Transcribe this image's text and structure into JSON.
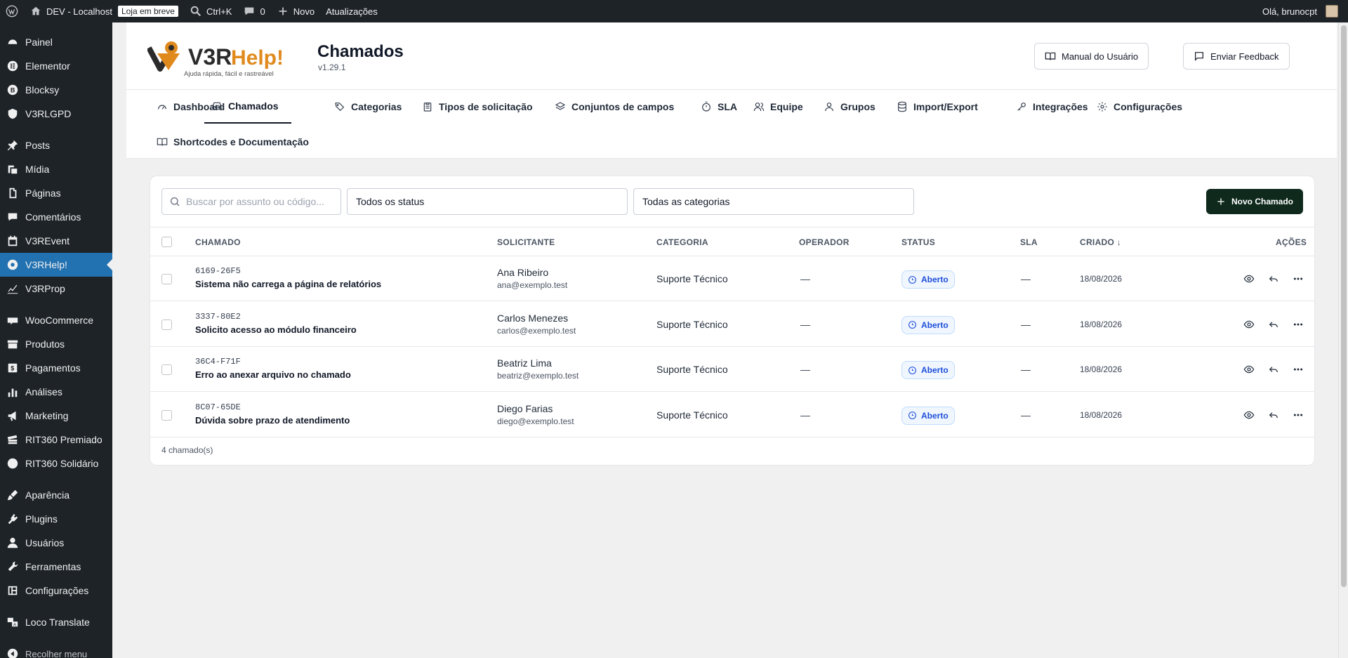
{
  "adminbar": {
    "site_name": "DEV - Localhost",
    "badge": "Loja em breve",
    "search_shortcut": "Ctrl+K",
    "comments_count": "0",
    "new_label": "Novo",
    "updates_label": "Atualizações",
    "greeting": "Olá, brunocpt"
  },
  "sidebar": {
    "items": [
      {
        "label": "Painel",
        "icon": "dashboard-icon"
      },
      {
        "label": "Elementor",
        "icon": "elementor-icon"
      },
      {
        "label": "Blocksy",
        "icon": "blocksy-icon"
      },
      {
        "label": "V3RLGPD",
        "icon": "shield-icon"
      },
      {
        "label": "Posts",
        "icon": "pin-icon"
      },
      {
        "label": "Mídia",
        "icon": "media-icon"
      },
      {
        "label": "Páginas",
        "icon": "pages-icon"
      },
      {
        "label": "Comentários",
        "icon": "comment-icon"
      },
      {
        "label": "V3REvent",
        "icon": "calendar-icon"
      },
      {
        "label": "V3RHelp!",
        "icon": "help-icon"
      },
      {
        "label": "V3RProp",
        "icon": "chart-icon"
      },
      {
        "label": "WooCommerce",
        "icon": "woo-icon"
      },
      {
        "label": "Produtos",
        "icon": "archive-icon"
      },
      {
        "label": "Pagamentos",
        "icon": "money-icon"
      },
      {
        "label": "Análises",
        "icon": "bar-chart-icon"
      },
      {
        "label": "Marketing",
        "icon": "megaphone-icon"
      },
      {
        "label": "RIT360 Premiado",
        "icon": "ticket-icon"
      },
      {
        "label": "RIT360 Solidário",
        "icon": "circle-icon"
      },
      {
        "label": "Aparência",
        "icon": "brush-icon"
      },
      {
        "label": "Plugins",
        "icon": "plugin-icon"
      },
      {
        "label": "Usuários",
        "icon": "user-icon"
      },
      {
        "label": "Ferramentas",
        "icon": "wrench-icon"
      },
      {
        "label": "Configurações",
        "icon": "settings-icon"
      },
      {
        "label": "Loco Translate",
        "icon": "translate-icon"
      },
      {
        "label": "Recolher menu",
        "icon": "collapse-icon"
      }
    ]
  },
  "header": {
    "logo_main": "V3R",
    "logo_accent": "Help!",
    "logo_tagline": "Ajuda rápida, fácil e rastreável",
    "title": "Chamados",
    "version": "v1.29.1",
    "manual_label": "Manual do Usuário",
    "feedback_label": "Enviar Feedback"
  },
  "tabs": [
    {
      "label": "Dashboard",
      "icon": "gauge-icon"
    },
    {
      "label": "Chamados",
      "icon": "inbox-icon"
    },
    {
      "label": "Categorias",
      "icon": "tags-icon"
    },
    {
      "label": "Tipos de solicitação",
      "icon": "clipboard-icon"
    },
    {
      "label": "Conjuntos de campos",
      "icon": "layers-icon"
    },
    {
      "label": "SLA",
      "icon": "timer-icon"
    },
    {
      "label": "Equipe",
      "icon": "users-icon"
    },
    {
      "label": "Grupos",
      "icon": "group-icon"
    },
    {
      "label": "Import/Export",
      "icon": "database-icon"
    },
    {
      "label": "Integrações",
      "icon": "key-icon"
    },
    {
      "label": "Configurações",
      "icon": "gear-icon"
    },
    {
      "label": "Shortcodes e Documentação",
      "icon": "book-icon"
    }
  ],
  "filters": {
    "search_placeholder": "Buscar por assunto ou código...",
    "status_value": "Todos os status",
    "category_value": "Todas as categorias",
    "new_ticket_label": "Novo Chamado"
  },
  "table": {
    "columns": {
      "ticket": "CHAMADO",
      "requester": "SOLICITANTE",
      "category": "CATEGORIA",
      "operator": "OPERADOR",
      "status": "STATUS",
      "sla": "SLA",
      "created": "CRIADO",
      "actions": "AÇÕES"
    },
    "rows": [
      {
        "code": "6169-26F5",
        "subject": "Sistema não carrega a página de relatórios",
        "name": "Ana Ribeiro",
        "email": "ana@exemplo.test",
        "category": "Suporte Técnico",
        "operator": "—",
        "status": "Aberto",
        "sla": "—",
        "created": "18/08/2026"
      },
      {
        "code": "3337-80E2",
        "subject": "Solicito acesso ao módulo financeiro",
        "name": "Carlos Menezes",
        "email": "carlos@exemplo.test",
        "category": "Suporte Técnico",
        "operator": "—",
        "status": "Aberto",
        "sla": "—",
        "created": "18/08/2026"
      },
      {
        "code": "36C4-F71F",
        "subject": "Erro ao anexar arquivo no chamado",
        "name": "Beatriz Lima",
        "email": "beatriz@exemplo.test",
        "category": "Suporte Técnico",
        "operator": "—",
        "status": "Aberto",
        "sla": "—",
        "created": "18/08/2026"
      },
      {
        "code": "8C07-65DE",
        "subject": "Dúvida sobre prazo de atendimento",
        "name": "Diego Farias",
        "email": "diego@exemplo.test",
        "category": "Suporte Técnico",
        "operator": "—",
        "status": "Aberto",
        "sla": "—",
        "created": "18/08/2026"
      }
    ],
    "count_label": "4 chamado(s)"
  }
}
